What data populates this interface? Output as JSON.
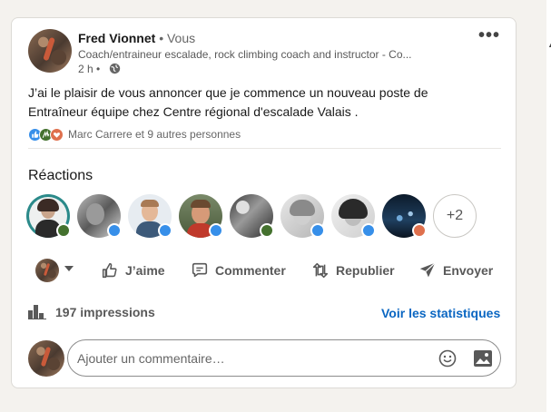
{
  "post": {
    "author": {
      "name": "Fred Vionnet",
      "relation": " • Vous",
      "headline": "Coach/entraineur escalade, rock climbing coach and instructor - Co...",
      "time": "2 h •"
    },
    "text_line1": "J’ai le plaisir de vous annoncer que je commence un nouveau poste de",
    "text_line2": "Entraîneur équipe chez Centre régional d'escalade Valais ."
  },
  "reactions_summary": {
    "text": "Marc Carrere et 9 autres personnes",
    "icons": [
      "like-icon",
      "celebrate-icon",
      "love-icon"
    ]
  },
  "reactions": {
    "title": "Réactions",
    "more_label": "+2",
    "people": [
      {
        "reaction": "celebrate",
        "badge_color": "#44712e"
      },
      {
        "reaction": "like",
        "badge_color": "#378fe9"
      },
      {
        "reaction": "like",
        "badge_color": "#378fe9"
      },
      {
        "reaction": "like",
        "badge_color": "#378fe9"
      },
      {
        "reaction": "celebrate",
        "badge_color": "#44712e"
      },
      {
        "reaction": "like",
        "badge_color": "#378fe9"
      },
      {
        "reaction": "like",
        "badge_color": "#378fe9"
      },
      {
        "reaction": "love",
        "badge_color": "#df704d"
      }
    ]
  },
  "actions": {
    "like": "J’aime",
    "comment": "Commenter",
    "repost": "Republier",
    "send": "Envoyer"
  },
  "analytics": {
    "impressions": "197 impressions",
    "stats_link": "Voir les statistiques"
  },
  "comment": {
    "placeholder": "Ajouter un commentaire…"
  },
  "colors": {
    "brand_blue": "#0a66c2",
    "like_blue": "#378fe9",
    "celebrate_green": "#44712e",
    "love_red": "#df704d"
  }
}
